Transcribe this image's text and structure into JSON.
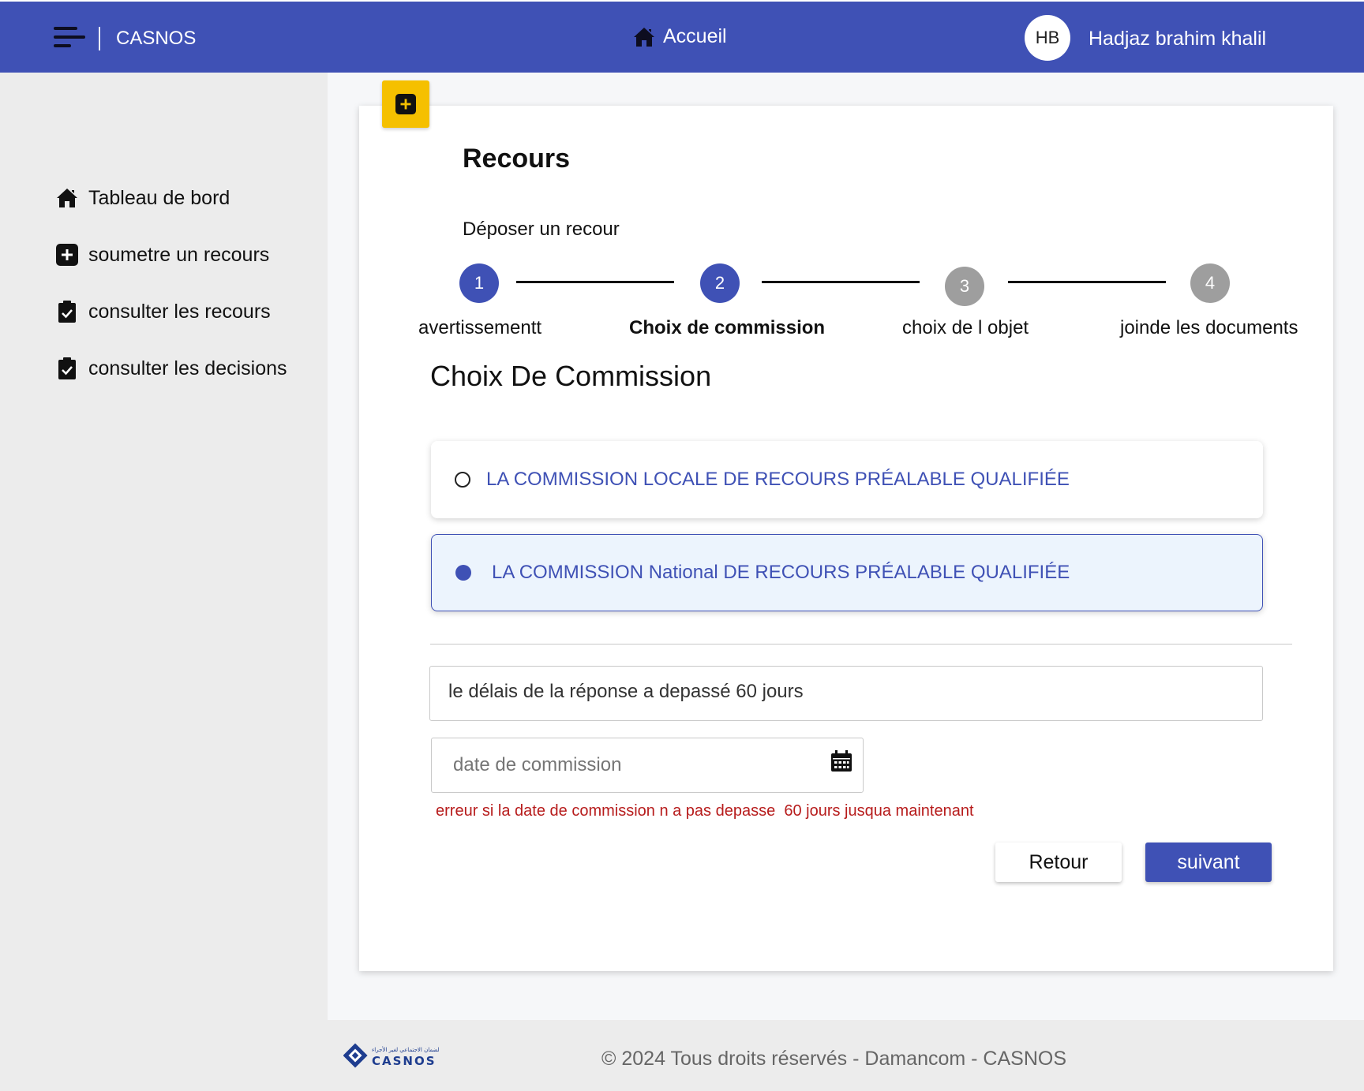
{
  "header": {
    "app_title": "CASNOS",
    "home_label": "Accueil",
    "user_initials": "HB",
    "user_name": "Hadjaz brahim khalil"
  },
  "sidebar": {
    "items": [
      {
        "label": "Tableau de bord",
        "icon": "home-icon"
      },
      {
        "label": "soumetre un recours",
        "icon": "plus-square-icon"
      },
      {
        "label": "consulter les recours",
        "icon": "clipboard-check-icon"
      },
      {
        "label": "consulter les decisions",
        "icon": "clipboard-check-icon"
      }
    ]
  },
  "card": {
    "title": "Recours",
    "subtitle": "Déposer un recour"
  },
  "stepper": {
    "steps": [
      {
        "number": "1",
        "label": "avertissementt",
        "state": "done"
      },
      {
        "number": "2",
        "label": "Choix de commission",
        "state": "current"
      },
      {
        "number": "3",
        "label": "choix de l objet",
        "state": "pending"
      },
      {
        "number": "4",
        "label": "joinde les documents",
        "state": "pending"
      }
    ]
  },
  "form": {
    "section_title": "Choix De Commission",
    "options": [
      {
        "label": "LA COMMISSION LOCALE DE RECOURS PRÉALABLE QUALIFIÉE",
        "selected": false
      },
      {
        "label": "LA COMMISSION National DE RECOURS PRÉALABLE QUALIFIÉE",
        "selected": true
      }
    ],
    "delay_field_value": "le délais de la réponse a depassé 60 jours",
    "date_placeholder": "date de commission",
    "error_message": "erreur si la date de commission n a pas depasse  60 jours jusqua maintenant",
    "back_label": "Retour",
    "next_label": "suivant"
  },
  "footer": {
    "copyright": "© 2024 Tous droits réservés - Damancom - CASNOS",
    "logo_text": "CASNOS",
    "logo_arabic": "الضمان الاجتماعي لغير الأجراء"
  },
  "colors": {
    "primary": "#3f51b5",
    "accent": "#f5c000",
    "error": "#b71c1c",
    "step_inactive": "#9e9e9e"
  }
}
